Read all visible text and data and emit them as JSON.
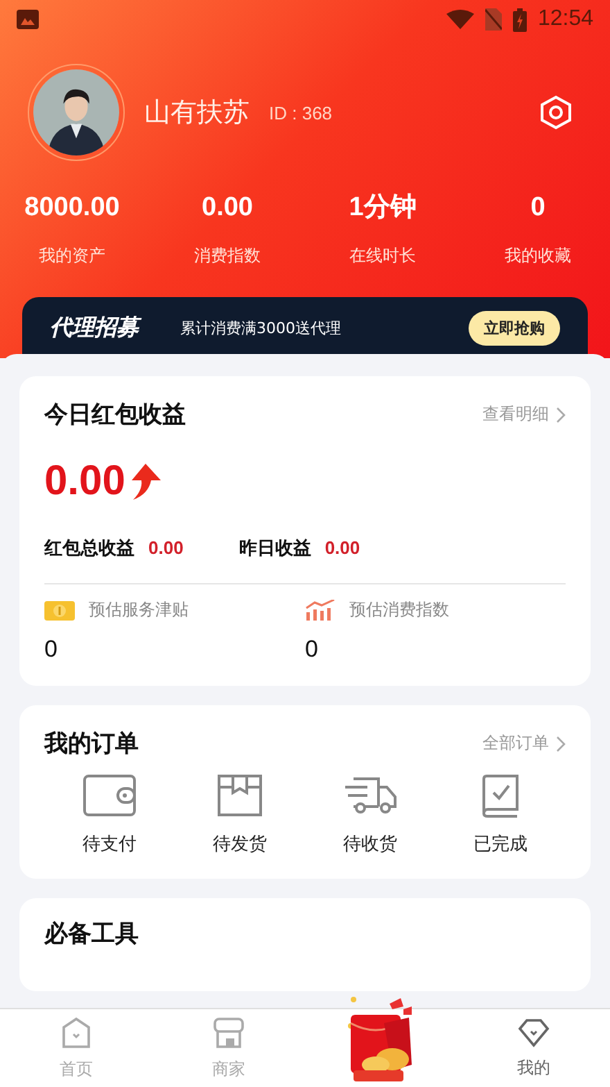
{
  "status_bar": {
    "time": "12:54"
  },
  "profile": {
    "name": "山有扶苏",
    "id": "ID : 368"
  },
  "stats": [
    {
      "value": "8000.00",
      "label": "我的资产"
    },
    {
      "value": "0.00",
      "label": "消费指数"
    },
    {
      "value": "1分钟",
      "label": "在线时长"
    },
    {
      "value": "0",
      "label": "我的收藏"
    }
  ],
  "banner": {
    "title": "代理招募",
    "text": "累计消费满3000送代理",
    "button": "立即抢购"
  },
  "earnings": {
    "title": "今日红包收益",
    "link": "查看明细",
    "amount": "0.00",
    "totals": [
      {
        "label": "红包总收益",
        "value": "0.00"
      },
      {
        "label": "昨日收益",
        "value": "0.00"
      }
    ],
    "estimates": [
      {
        "kind": "coin",
        "label": "预估服务津贴",
        "value": "0"
      },
      {
        "kind": "chart",
        "label": "预估消费指数",
        "value": "0"
      }
    ]
  },
  "orders": {
    "title": "我的订单",
    "link": "全部订单",
    "items": [
      {
        "kind": "wallet",
        "label": "待支付"
      },
      {
        "kind": "box",
        "label": "待发货"
      },
      {
        "kind": "truck",
        "label": "待收货"
      },
      {
        "kind": "done",
        "label": "已完成"
      }
    ]
  },
  "tools": {
    "title": "必备工具"
  },
  "tab_bar": [
    {
      "kind": "home",
      "label": "首页",
      "selected": false
    },
    {
      "kind": "shop",
      "label": "商家",
      "selected": false
    },
    {
      "kind": "packet"
    },
    {
      "kind": "diamond",
      "label": "我的",
      "selected": true
    }
  ]
}
